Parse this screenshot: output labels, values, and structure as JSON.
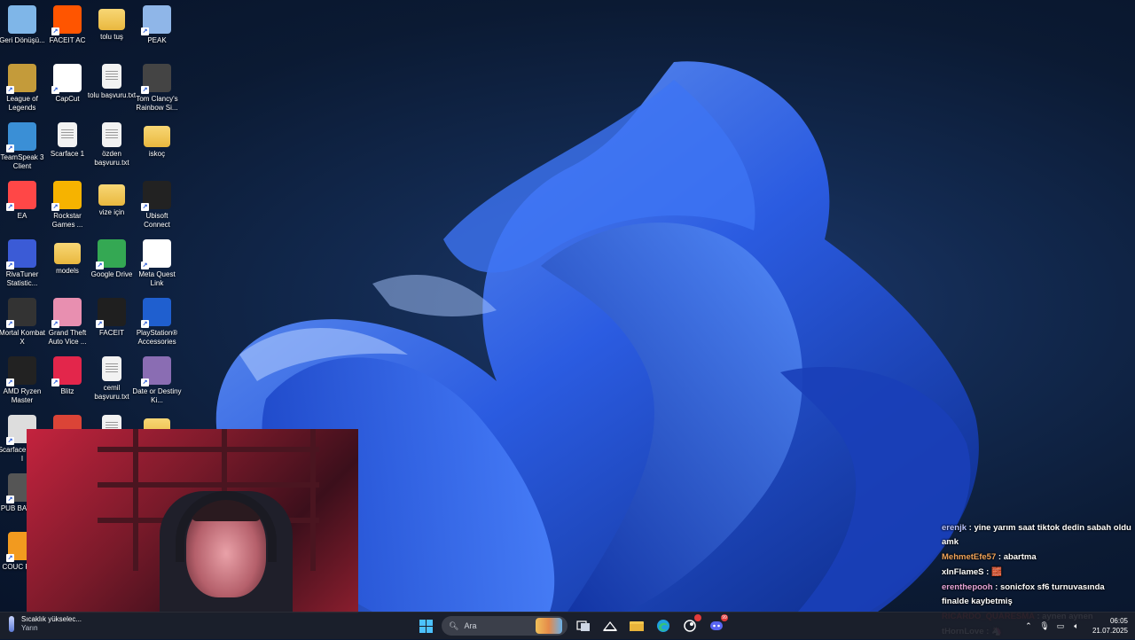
{
  "desktop": {
    "icons": [
      {
        "label": "Geri Dönüşü...",
        "icon": "recycle-bin-icon",
        "color": "#7fb6e8"
      },
      {
        "label": "FACEIT AC",
        "icon": "faceit-ac-icon",
        "color": "#ff5500"
      },
      {
        "label": "tolu tuş",
        "icon": "folder-icon",
        "color": "#f3c74f"
      },
      {
        "label": "PEAK",
        "icon": "peak-icon",
        "color": "#8fb6e8"
      },
      {
        "label": "League of Legends",
        "icon": "league-of-legends-icon",
        "color": "#c49b3a"
      },
      {
        "label": "CapCut",
        "icon": "capcut-icon",
        "color": "#ffffff"
      },
      {
        "label": "tolu başvuru.txt",
        "icon": "text-file-icon",
        "color": "#eeeeee"
      },
      {
        "label": "Tom Clancy's Rainbow Si...",
        "icon": "rainbow-six-icon",
        "color": "#444444"
      },
      {
        "label": "TeamSpeak 3 Client",
        "icon": "teamspeak-icon",
        "color": "#3a8fd6"
      },
      {
        "label": "Scarface 1",
        "icon": "blank-file-icon",
        "color": "#eeeeee"
      },
      {
        "label": "özden başvuru.txt",
        "icon": "text-file-icon",
        "color": "#eeeeee"
      },
      {
        "label": "iskoç",
        "icon": "folder-icon",
        "color": "#f3c74f"
      },
      {
        "label": "EA",
        "icon": "ea-icon",
        "color": "#ff4747"
      },
      {
        "label": "Rockstar Games ...",
        "icon": "rockstar-icon",
        "color": "#f6b300"
      },
      {
        "label": "vize için",
        "icon": "folder-icon",
        "color": "#f3c74f"
      },
      {
        "label": "Ubisoft Connect",
        "icon": "ubisoft-icon",
        "color": "#222222"
      },
      {
        "label": "RivaTuner Statistic...",
        "icon": "rivatuner-icon",
        "color": "#3b5bd6"
      },
      {
        "label": "models",
        "icon": "folder-icon",
        "color": "#f3c74f"
      },
      {
        "label": "Google Drive",
        "icon": "google-drive-icon",
        "color": "#34a853"
      },
      {
        "label": "Meta Quest Link",
        "icon": "meta-quest-icon",
        "color": "#ffffff"
      },
      {
        "label": "Mortal Kombat X",
        "icon": "mortal-kombat-icon",
        "color": "#333333"
      },
      {
        "label": "Grand Theft Auto Vice ...",
        "icon": "gta-vice-city-icon",
        "color": "#e88fb0"
      },
      {
        "label": "FACEIT",
        "icon": "faceit-icon",
        "color": "#1f1f1f"
      },
      {
        "label": "PlayStation® Accessories",
        "icon": "playstation-icon",
        "color": "#1f5fcf"
      },
      {
        "label": "AMD Ryzen Master",
        "icon": "amd-ryzen-icon",
        "color": "#222222"
      },
      {
        "label": "Blitz",
        "icon": "blitz-icon",
        "color": "#e3264b"
      },
      {
        "label": "cemil başvuru.txt",
        "icon": "text-file-icon",
        "color": "#eeeeee"
      },
      {
        "label": "Date or Destiny Ki...",
        "icon": "date-or-destiny-icon",
        "color": "#8a6db3"
      },
      {
        "label": "Scarface World I",
        "icon": "scarface-world-icon",
        "color": "#dddddd"
      },
      {
        "label": "",
        "icon": "chrome-icon",
        "color": "#db4437"
      },
      {
        "label": "",
        "icon": "text-file-icon",
        "color": "#eeeeee"
      },
      {
        "label": "",
        "icon": "folder-icon",
        "color": "#f3c74f"
      },
      {
        "label": "PUB BATTLE",
        "icon": "pubg-icon",
        "color": "#555555"
      },
      {
        "label": "COUC PURI",
        "icon": "ui-app-icon",
        "color": "#f29a1f"
      }
    ]
  },
  "chat": {
    "messages": [
      {
        "user": "erenjk",
        "user_color": "#b9c4ff",
        "text": " : yine yarım saat tiktok dedin sabah oldu amk"
      },
      {
        "user": "MehmetEfe57",
        "user_color": "#f0a35a",
        "text": " : abartma"
      },
      {
        "user": "xInFlameS",
        "user_color": "#ffffff",
        "text": " : 🧱"
      },
      {
        "user": "erenthepooh",
        "user_color": "#e6a4d8",
        "text": " : sonicfox sf6 turnuvasında finalde kaybetmiş"
      },
      {
        "user": "RICARDO_QUARESMA",
        "user_color": "#e03b3b",
        "text": " : aynen aynen"
      },
      {
        "user": "tHornLove",
        "user_color": "#ffffff",
        "text": " : 🦄"
      }
    ]
  },
  "taskbar": {
    "weather_title": "Sıcaklık yükselec...",
    "weather_sub": "Yarın",
    "search_placeholder": "Ara",
    "time": "06:05",
    "date": "21.07.2025",
    "discord_badge": "99"
  }
}
